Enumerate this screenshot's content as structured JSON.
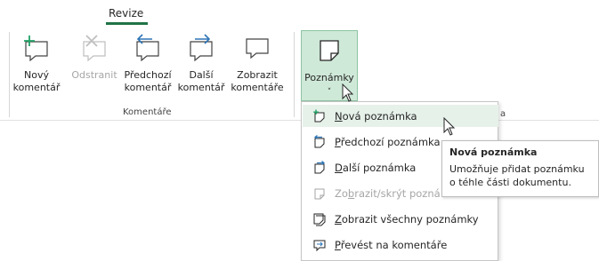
{
  "ribbon": {
    "active_tab": "Revize",
    "group": {
      "label": "Komentáře",
      "buttons": [
        {
          "line1": "Nový",
          "line2": "komentář",
          "icon": "new-comment-icon",
          "enabled": true
        },
        {
          "line1": "Odstranit",
          "line2": "",
          "icon": "delete-comment-icon",
          "enabled": false
        },
        {
          "line1": "Předchozí",
          "line2": "komentář",
          "icon": "previous-comment-icon",
          "enabled": true
        },
        {
          "line1": "Další",
          "line2": "komentář",
          "icon": "next-comment-icon",
          "enabled": true
        },
        {
          "line1": "Zobrazit",
          "line2": "komentáře",
          "icon": "show-comments-icon",
          "enabled": true
        }
      ]
    },
    "notes_button": {
      "label": "Poznámky",
      "chevron": "˅",
      "icon": "note-icon"
    },
    "hidden_fragment": "a"
  },
  "menu": {
    "items": [
      {
        "accel": "N",
        "rest": "ová poznámka",
        "icon": "new-note-icon",
        "enabled": true,
        "hover": true
      },
      {
        "accel": "P",
        "rest": "ředchozí poznámka",
        "icon": "previous-note-icon",
        "enabled": true
      },
      {
        "accel": "D",
        "rest": "alší poznámka",
        "icon": "next-note-icon",
        "enabled": true
      },
      {
        "pre": "Zo",
        "accel": "b",
        "rest": "razit/skrýt pozná",
        "icon": "show-hide-note-icon",
        "enabled": false
      },
      {
        "accel": "Z",
        "rest": "obrazit všechny poznámky",
        "icon": "show-all-notes-icon",
        "enabled": true
      },
      {
        "accel": "P",
        "rest": "řevést na komentáře",
        "icon": "convert-to-comments-icon",
        "enabled": true
      }
    ]
  },
  "tooltip": {
    "title": "Nová poznámka",
    "line1": "Umožňuje přidat poznámku",
    "line2": "o téhle části dokumentu."
  },
  "colors": {
    "accent": "#217346",
    "hover": "#e6f1ea",
    "notes_bg": "#cfe9d8",
    "icon_blue": "#2e75b6",
    "icon_green": "#21a366"
  }
}
